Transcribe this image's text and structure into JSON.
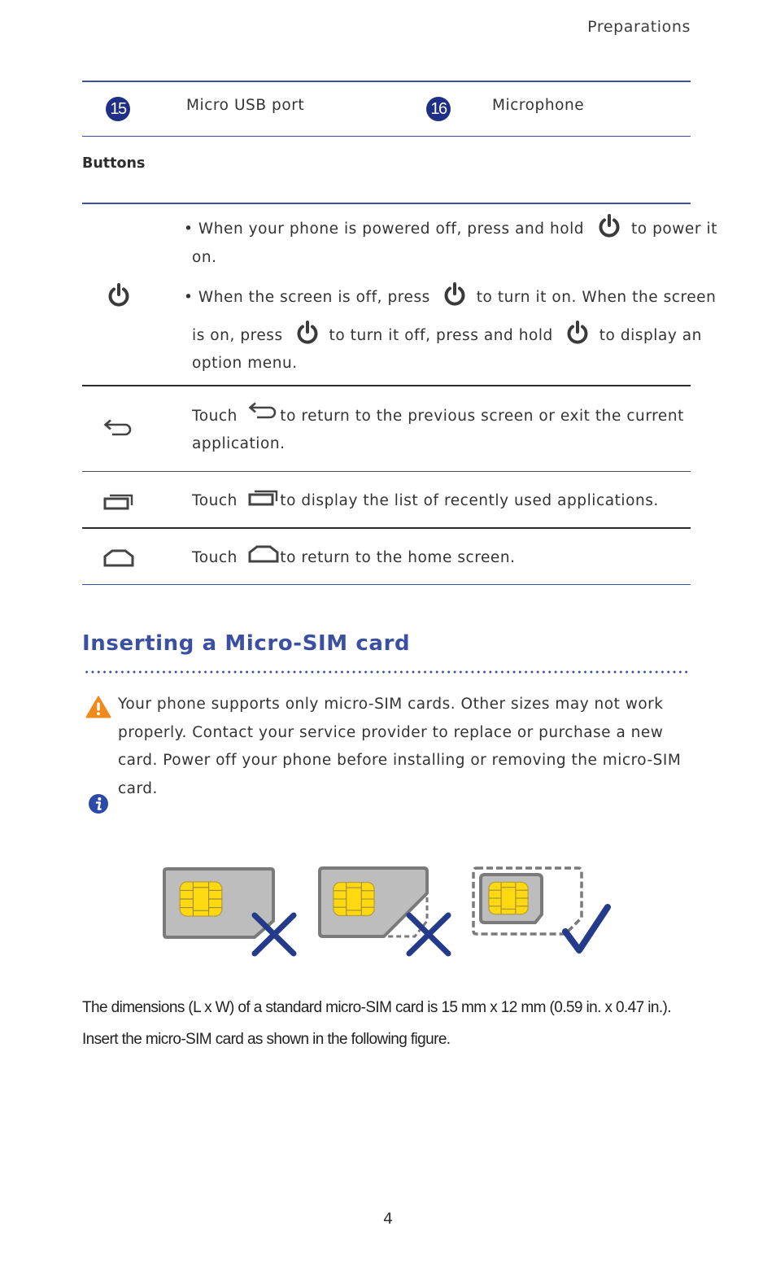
{
  "header": {
    "section": "Preparations"
  },
  "components": [
    {
      "number": "15",
      "label": "Micro USB port"
    },
    {
      "number": "16",
      "label": "Microphone"
    }
  ],
  "buttons_section": {
    "title": "Buttons",
    "rows": [
      {
        "icon": "power-icon",
        "bullets": [
          {
            "before": "When your phone is powered off, press and hold",
            "after_line1": "to power it",
            "after_line2": "on."
          },
          {
            "before": "When the screen is off, press",
            "after_line1": "to turn it on. When the screen",
            "line2_before": "is on, press",
            "line2_mid": "to turn it off, press and hold",
            "line2_after": "to display an",
            "line3": "option menu."
          }
        ]
      },
      {
        "icon": "back-icon",
        "prefix": "Touch",
        "line1": "to return to the previous screen or exit the current",
        "line2": "application."
      },
      {
        "icon": "recent-apps-icon",
        "prefix": "Touch",
        "line1": "to display the list of recently used applications."
      },
      {
        "icon": "home-icon",
        "prefix": "Touch",
        "line1": "to return to the home screen."
      }
    ]
  },
  "sim_section": {
    "heading": "Inserting a Micro-SIM card",
    "warning": {
      "icon": "warning-icon",
      "text": "Your phone supports only micro-SIM cards. Other sizes may not work properly. Contact your service provider to replace or purchase a new card. Power off your phone before installing or removing the micro-SIM card."
    },
    "info": {
      "icon": "info-icon"
    },
    "figure": {
      "items": [
        {
          "name": "standard-sim",
          "status": "wrong"
        },
        {
          "name": "cut-sim",
          "status": "wrong"
        },
        {
          "name": "micro-sim",
          "status": "correct"
        }
      ],
      "colors": {
        "card": "#bdbdbd",
        "card_border": "#7a7a7a",
        "chip": "#ffd90f",
        "mark": "#243b8c"
      }
    },
    "dimensions_text": "The dimensions (L x W) of a standard micro-SIM card is 15 mm x 12 mm (0.59 in. x 0.47 in.).",
    "insert_text": "Insert the micro-SIM card as shown in the following figure."
  },
  "footer": {
    "page_number": "4"
  },
  "colors": {
    "accent": "#3b4fa3",
    "badge": "#1f2f86",
    "warning": "#f08a1c",
    "text": "#333333"
  }
}
